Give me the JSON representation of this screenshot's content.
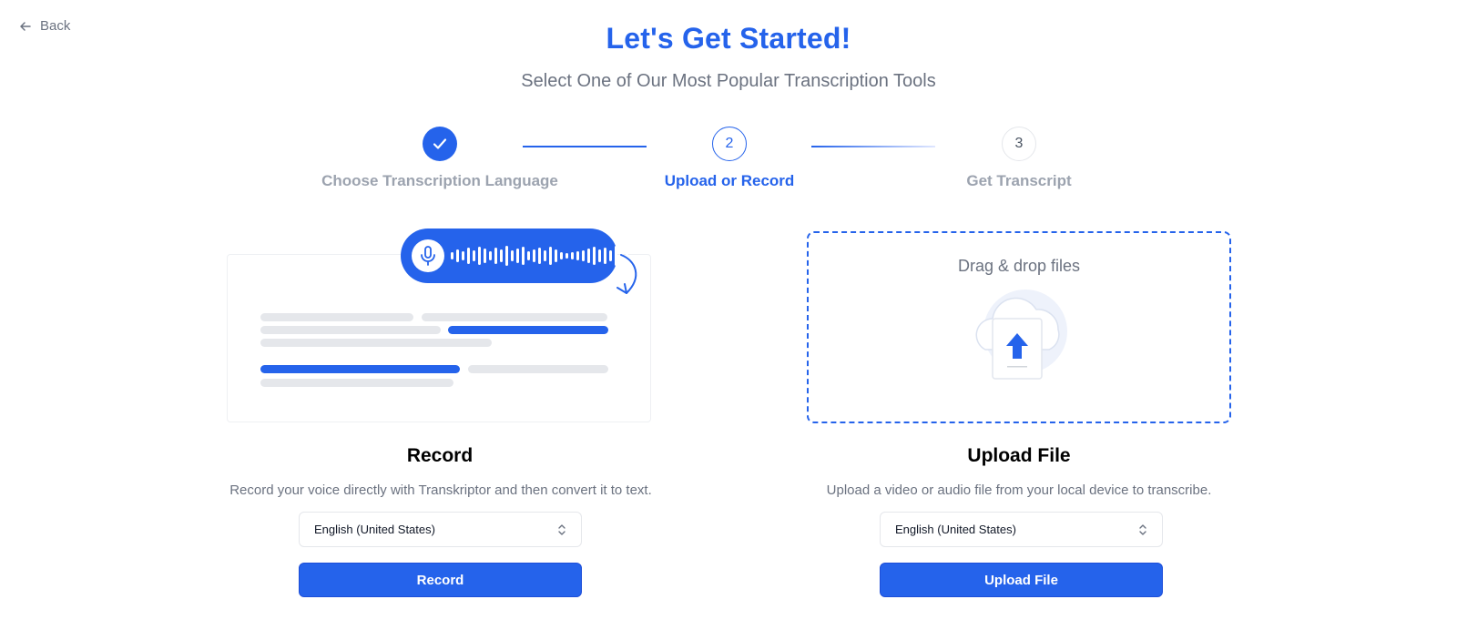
{
  "nav": {
    "back_label": "Back"
  },
  "header": {
    "title": "Let's Get Started!",
    "subtitle": "Select One of Our Most Popular Transcription Tools"
  },
  "steps": [
    {
      "number": "1",
      "label": "Choose Transcription Language",
      "state": "complete"
    },
    {
      "number": "2",
      "label": "Upload or Record",
      "state": "active"
    },
    {
      "number": "3",
      "label": "Get Transcript",
      "state": "pending"
    }
  ],
  "record": {
    "title": "Record",
    "description": "Record your voice directly with Transkriptor and then convert it to text.",
    "language": "English (United States)",
    "button_label": "Record"
  },
  "upload": {
    "dropzone_text": "Drag & drop files",
    "title": "Upload File",
    "description": "Upload a video or audio file from your local device to transcribe.",
    "language": "English (United States)",
    "button_label": "Upload File"
  },
  "colors": {
    "accent": "#2563eb",
    "muted": "#9ca3af"
  }
}
